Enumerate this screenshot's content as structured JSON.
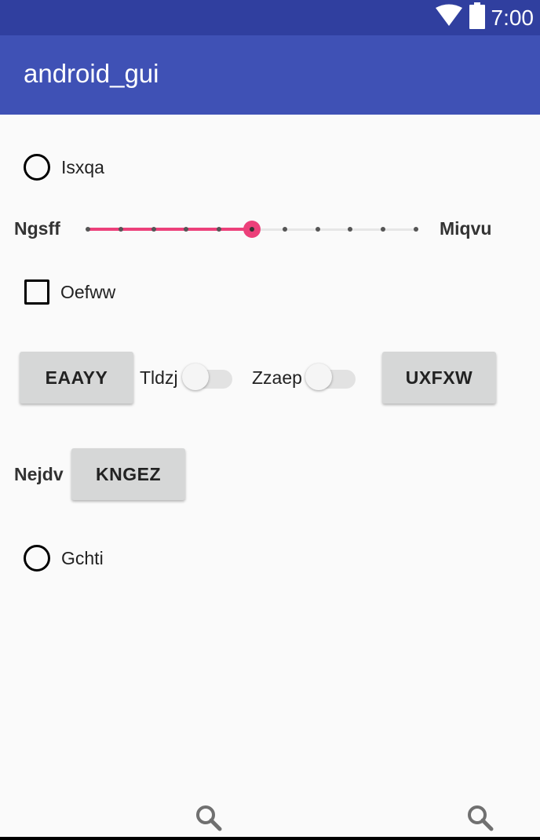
{
  "status_bar": {
    "time": "7:00",
    "icons": [
      "wifi-icon",
      "battery-icon"
    ],
    "background": "#303f9f"
  },
  "app_bar": {
    "title": "android_gui",
    "background": "#3f51b5"
  },
  "widgets": {
    "radio_1": {
      "label": "Isxqa",
      "checked": false
    },
    "seekbar": {
      "left_label": "Ngsff",
      "right_label": "Miqvu",
      "value": 5,
      "max": 10,
      "accent": "#ec407a"
    },
    "checkbox": {
      "label": "Oefww",
      "checked": false
    },
    "button_1": {
      "label": "EAAYY"
    },
    "switch_1": {
      "label": "Tldzj",
      "on": false
    },
    "switch_2": {
      "label": "Zzaep",
      "on": false
    },
    "button_2": {
      "label": "UXFXW"
    },
    "text_label": "Nejdv",
    "button_3": {
      "label": "KNGEZ"
    },
    "radio_2": {
      "label": "Gchti",
      "checked": false
    }
  },
  "nav_bar": {
    "icons": [
      "search-icon",
      "search-icon"
    ]
  }
}
